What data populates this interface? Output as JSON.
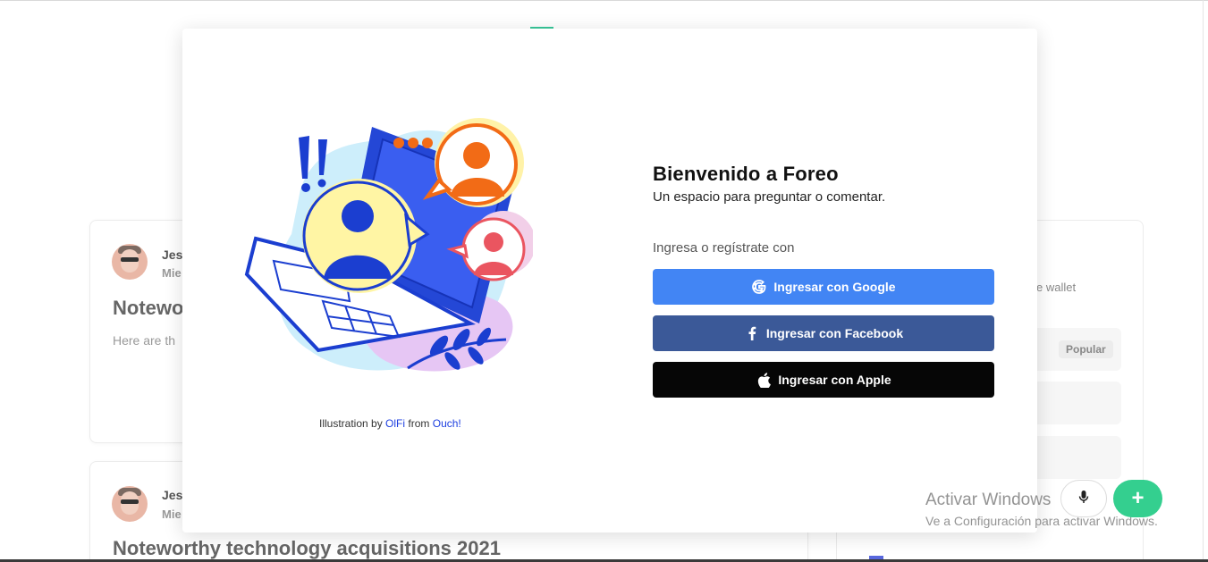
{
  "background": {
    "posts": [
      {
        "author": "Jes",
        "meta": "Mie",
        "title": "Notewo",
        "excerpt": "Here are th"
      },
      {
        "author": "Jes",
        "meta": "Mie",
        "title": "Noteworthy technology acquisitions 2021"
      }
    ],
    "sidebar": {
      "text_fragment": "e wallet",
      "badge": "Popular"
    }
  },
  "modal": {
    "title": "Bienvenido a Foreo",
    "subtitle": "Un espacio para preguntar o comentar.",
    "prompt": "Ingresa o regístrate con",
    "buttons": {
      "google": "Ingresar con Google",
      "facebook": "Ingresar con Facebook",
      "apple": "Ingresar con Apple"
    },
    "credit": {
      "prefix": "Illustration by",
      "artist": "OlFi",
      "middle": "from",
      "source": "Ouch!"
    }
  },
  "windows_watermark": {
    "line1": "Activar Windows",
    "line2": "Ve a Configuración para activar Windows."
  },
  "fab": {
    "mic_icon": "microphone-icon",
    "plus_label": "+"
  },
  "colors": {
    "google": "#4285f4",
    "facebook": "#3b5998",
    "apple": "#060606",
    "fab_green": "#34cf8f"
  }
}
